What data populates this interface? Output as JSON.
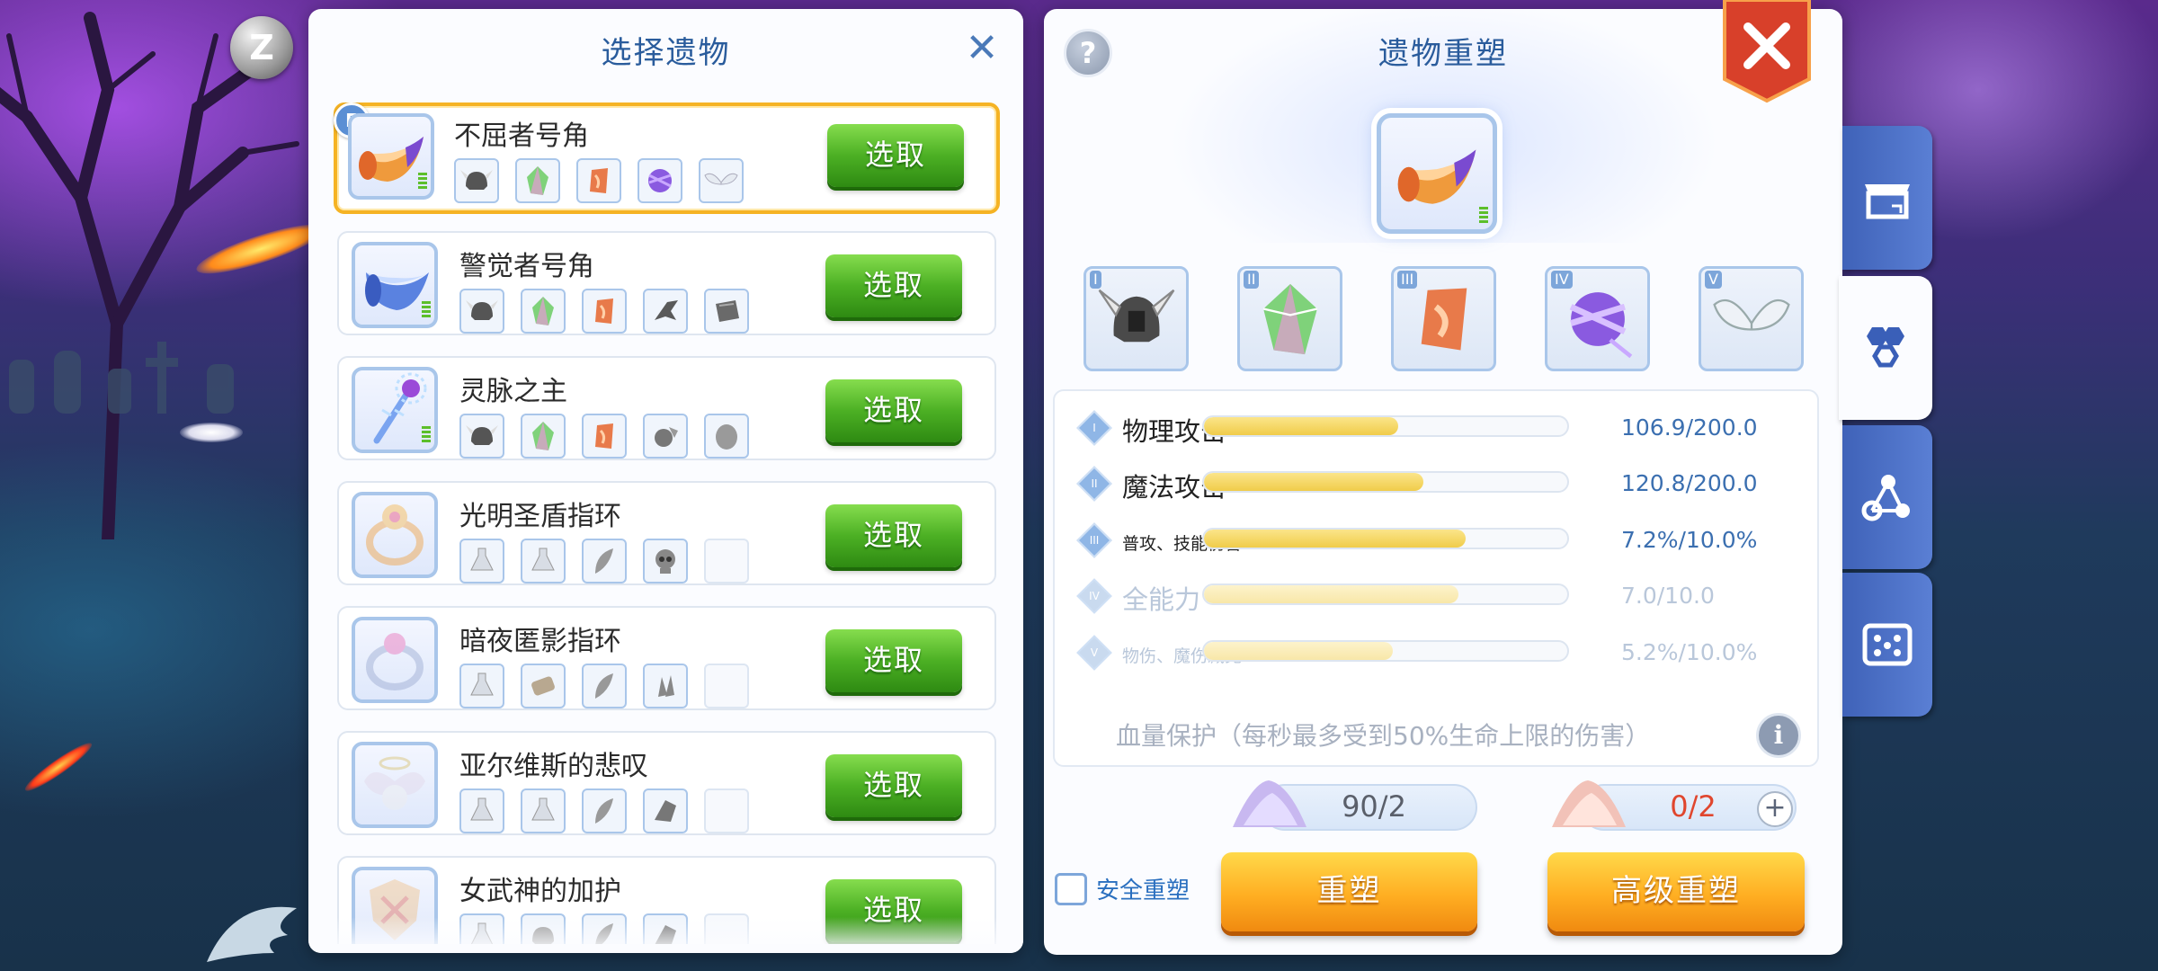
{
  "left_panel": {
    "title": "选择遗物",
    "items": [
      {
        "name": "不屈者号角",
        "pick_label": "选取",
        "selected": true,
        "badge": "E"
      },
      {
        "name": "警觉者号角",
        "pick_label": "选取"
      },
      {
        "name": "灵脉之主",
        "pick_label": "选取"
      },
      {
        "name": "光明圣盾指环",
        "pick_label": "选取"
      },
      {
        "name": "暗夜匿影指环",
        "pick_label": "选取"
      },
      {
        "name": "亚尔维斯的悲叹",
        "pick_label": "选取"
      },
      {
        "name": "女武神的加护",
        "pick_label": "选取"
      }
    ]
  },
  "right_panel": {
    "title": "遗物重塑",
    "attr_slots": [
      "I",
      "II",
      "III",
      "IV",
      "V"
    ],
    "stats": [
      {
        "roman": "I",
        "label": "物理攻击",
        "value": "106.9/200.0",
        "fill": 0.5345
      },
      {
        "roman": "II",
        "label": "魔法攻击",
        "value": "120.8/200.0",
        "fill": 0.604
      },
      {
        "roman": "III",
        "label": "普攻、技能伤害",
        "value": "7.2%/10.0%",
        "fill": 0.72
      },
      {
        "roman": "IV",
        "label": "全能力",
        "value": "7.0/10.0",
        "fill": 0.7
      },
      {
        "roman": "V",
        "label": "物伤、魔伤减免",
        "value": "5.2%/10.0%",
        "fill": 0.52
      }
    ],
    "protect_text": "血量保护（每秒最多受到50%生命上限的伤害）",
    "cost_normal": "90/2",
    "cost_advanced": "0/2",
    "safe_label": "安全重塑",
    "reforge_label": "重塑",
    "adv_reforge_label": "高级重塑"
  },
  "hud": {
    "z_badge": "Z",
    "help": "?",
    "info": "i",
    "plus": "+"
  },
  "colors": {
    "accent": "#2a5c9c",
    "pick_green": "#4cb024",
    "gold": "#ffae22",
    "selected_border": "#f5b324",
    "red_value": "#e0462e"
  }
}
